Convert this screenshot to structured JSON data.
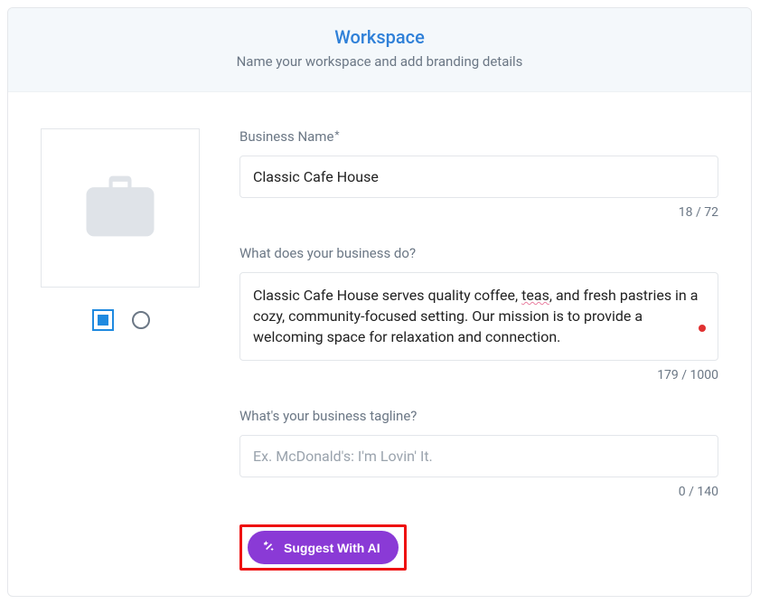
{
  "header": {
    "title": "Workspace",
    "subtitle": "Name your workspace and add branding details"
  },
  "businessName": {
    "label": "Business Name",
    "required_mark": "*",
    "value": "Classic Cafe House",
    "counter": "18 / 72"
  },
  "description": {
    "label": "What does your business do?",
    "value_pre": "Classic Cafe House serves quality coffee, ",
    "value_spell": "teas",
    "value_post": ", and fresh pastries in a cozy, community-focused setting. Our mission is to provide a welcoming space for relaxation and connection.",
    "counter": "179 / 1000"
  },
  "tagline": {
    "label": "What's your business tagline?",
    "placeholder": "Ex. McDonald's: I'm Lovin' It.",
    "value": "",
    "counter": "0 / 140"
  },
  "suggest": {
    "label": "Suggest With AI"
  }
}
